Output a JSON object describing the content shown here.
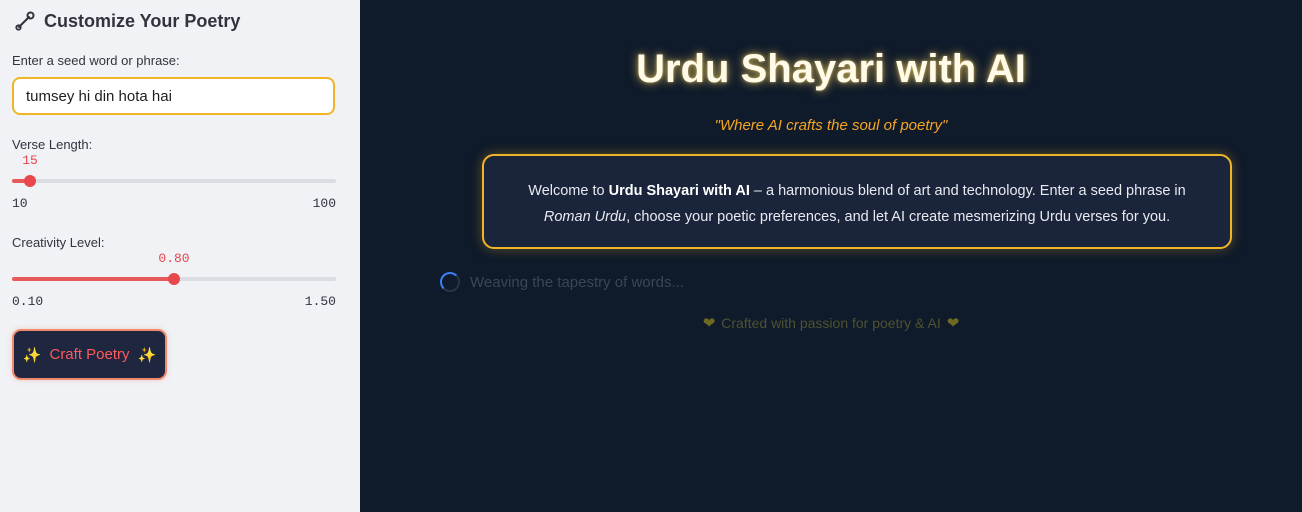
{
  "sidebar": {
    "icon": "wrench-icon",
    "title": "Customize Your Poetry",
    "seed_label": "Enter a seed word or phrase:",
    "seed_value": "tumsey hi din hota hai",
    "verse_length": {
      "label": "Verse Length:",
      "value": "15",
      "min": "10",
      "max": "100"
    },
    "creativity": {
      "label": "Creativity Level:",
      "value": "0.80",
      "min": "0.10",
      "max": "1.50"
    },
    "craft_button": {
      "label": "Craft Poetry",
      "spark_left": "✨",
      "spark_right": "✨"
    }
  },
  "main": {
    "title": "Urdu Shayari with AI",
    "tagline": "\"Where AI crafts the soul of poetry\"",
    "welcome": {
      "prefix": "Welcome to ",
      "brand": "Urdu Shayari with AI",
      "middle": " – a harmonious blend of art and technology. Enter a seed phrase in ",
      "italic": "Roman Urdu",
      "suffix": ", choose your poetic preferences, and let AI create mesmerizing Urdu verses for you."
    },
    "spinner_text": "Weaving the tapestry of words...",
    "footer": {
      "heart": "❤",
      "text": "Crafted with passion for poetry & AI"
    }
  },
  "colors": {
    "accent": "#f0b429",
    "slider": "#e8474b",
    "bg": "#0f1a2a",
    "sidebar_bg": "#f0f2f6",
    "spinner": "#3b82f6"
  }
}
